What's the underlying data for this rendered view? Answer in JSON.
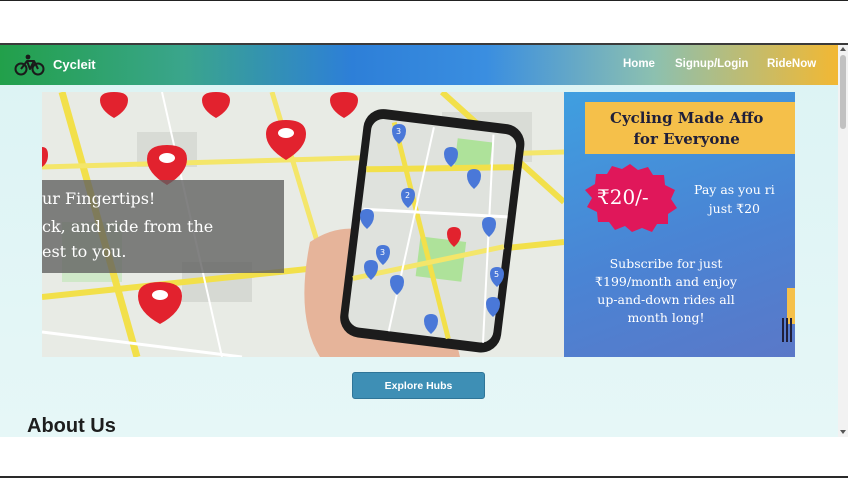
{
  "navbar": {
    "brand": "Cycleit",
    "links": [
      "Home",
      "Signup/Login",
      "RideNow"
    ]
  },
  "hero": {
    "overlay_lines": [
      "ur Fingertips!",
      "ck, and ride from the",
      "est to you."
    ],
    "promo": {
      "heading": "Cycling Made Affo\nfor Everyone",
      "price": "₹20/-",
      "pay_text": "Pay as you ri\njust ₹20",
      "subscribe_text": "Subscribe for just ₹199/month and enjoy up-and-down rides all month long!"
    },
    "map_pin_numbers": [
      "3",
      "2",
      "3",
      "5"
    ]
  },
  "explore_button": "Explore Hubs",
  "about": {
    "title": "About Us"
  },
  "colors": {
    "accent_green": "#22a04a",
    "accent_blue": "#2d7fd8",
    "accent_yellow": "#f2b833",
    "pin_red": "#e2222e",
    "pin_blue": "#4a78d8",
    "button": "#3e8fb5"
  }
}
